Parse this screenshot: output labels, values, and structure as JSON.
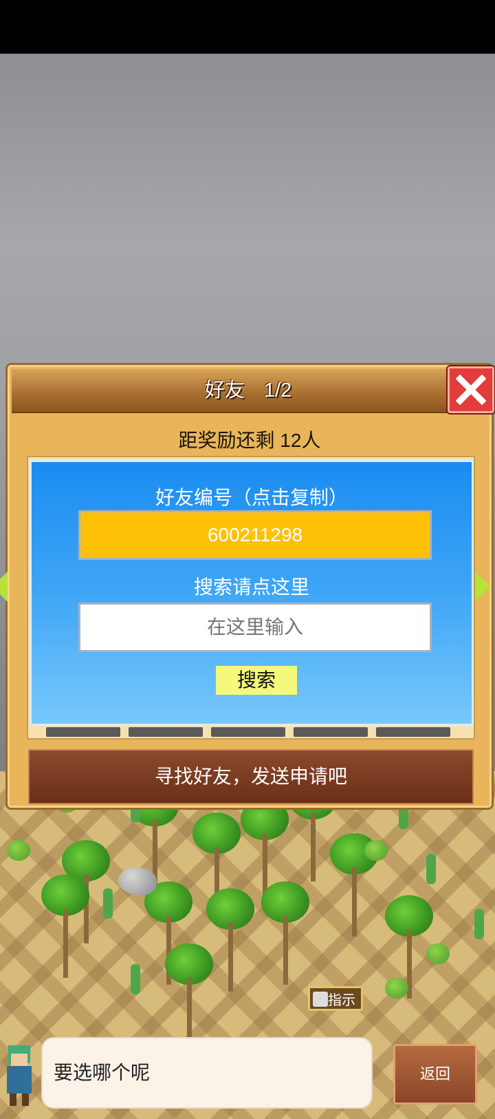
{
  "dialog": {
    "title": "好友",
    "page": "1/2",
    "subtitle": "距奖励还剩 12人",
    "id_label": "好友编号（点击复制）",
    "friend_id": "600211298",
    "search_label": "搜索请点这里",
    "search_placeholder": "在这里输入",
    "search_button": "搜索",
    "footer": "寻找好友，发送申请吧"
  },
  "guide": {
    "label": "指示"
  },
  "chat": {
    "message": "要选哪个呢"
  },
  "back": {
    "label": "返回"
  },
  "icons": [
    "close-icon",
    "arrow-left-icon",
    "arrow-right-icon",
    "guide-book-icon"
  ],
  "colors": {
    "header": "#a66d2e",
    "panel": "#3fa6f6",
    "id_box": "#ffc107",
    "search_button": "#f5f97a",
    "close": "#e23c3c",
    "footer": "#7a3a20"
  }
}
